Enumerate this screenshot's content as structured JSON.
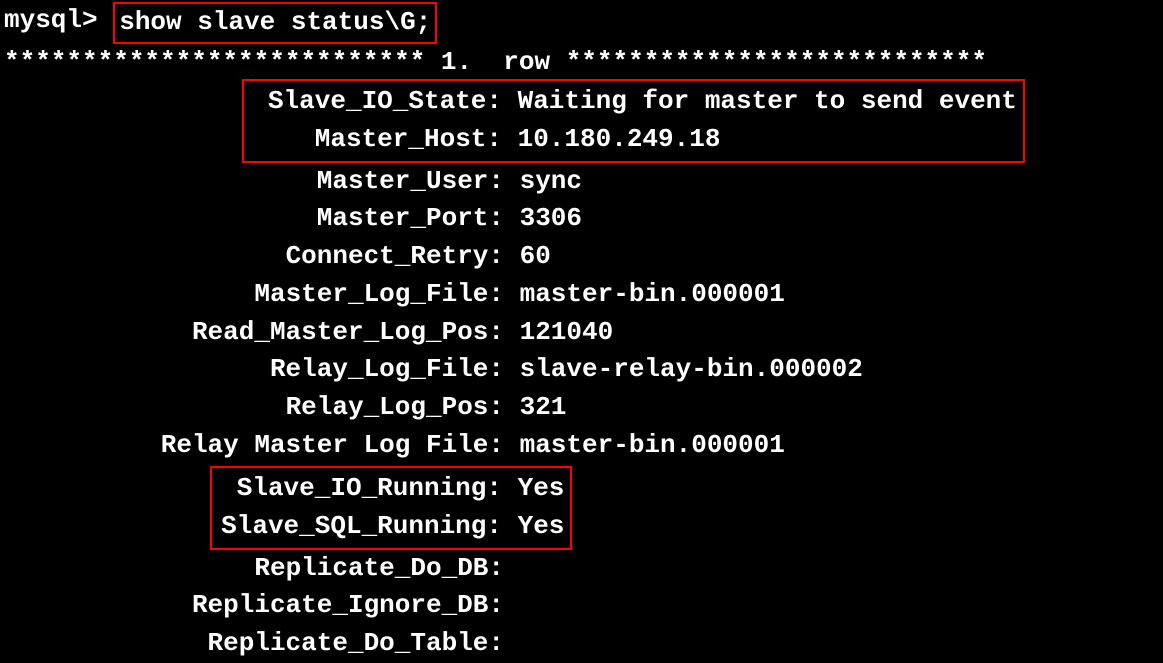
{
  "prompt": "mysql> ",
  "command": "show slave status\\G;",
  "row_header_left": "*************************** 1.",
  "row_header_mid": "  row ",
  "row_header_right": "***************************",
  "highlight1": {
    "slave_io_state_label": "Slave_IO_State:",
    "slave_io_state_value": " Waiting for master to send event",
    "master_host_label": "Master_Host:",
    "master_host_value": " 10.180.249.18"
  },
  "fields": {
    "master_user_label": "Master_User:",
    "master_user_value": " sync",
    "master_port_label": "Master_Port:",
    "master_port_value": " 3306",
    "connect_retry_label": "Connect_Retry:",
    "connect_retry_value": " 60",
    "master_log_file_label": "Master_Log_File:",
    "master_log_file_value": " master-bin.000001",
    "read_master_log_pos_label": "Read_Master_Log_Pos:",
    "read_master_log_pos_value": " 121040",
    "relay_log_file_label": "Relay_Log_File:",
    "relay_log_file_value": " slave-relay-bin.000002",
    "relay_log_pos_label": "Relay_Log_Pos:",
    "relay_log_pos_value": " 321",
    "relay_master_log_file_label": "Relay Master Log File:",
    "relay_master_log_file_value": " master-bin.000001"
  },
  "highlight2": {
    "slave_io_running_label": "Slave_IO_Running:",
    "slave_io_running_value": " Yes",
    "slave_sql_running_label": "Slave_SQL_Running:",
    "slave_sql_running_value": " Yes"
  },
  "fields2": {
    "replicate_do_db_label": "Replicate_Do_DB:",
    "replicate_do_db_value": "",
    "replicate_ignore_db_label": "Replicate_Ignore_DB:",
    "replicate_ignore_db_value": "",
    "replicate_do_table_label": "Replicate_Do_Table:",
    "replicate_do_table_value": ""
  }
}
